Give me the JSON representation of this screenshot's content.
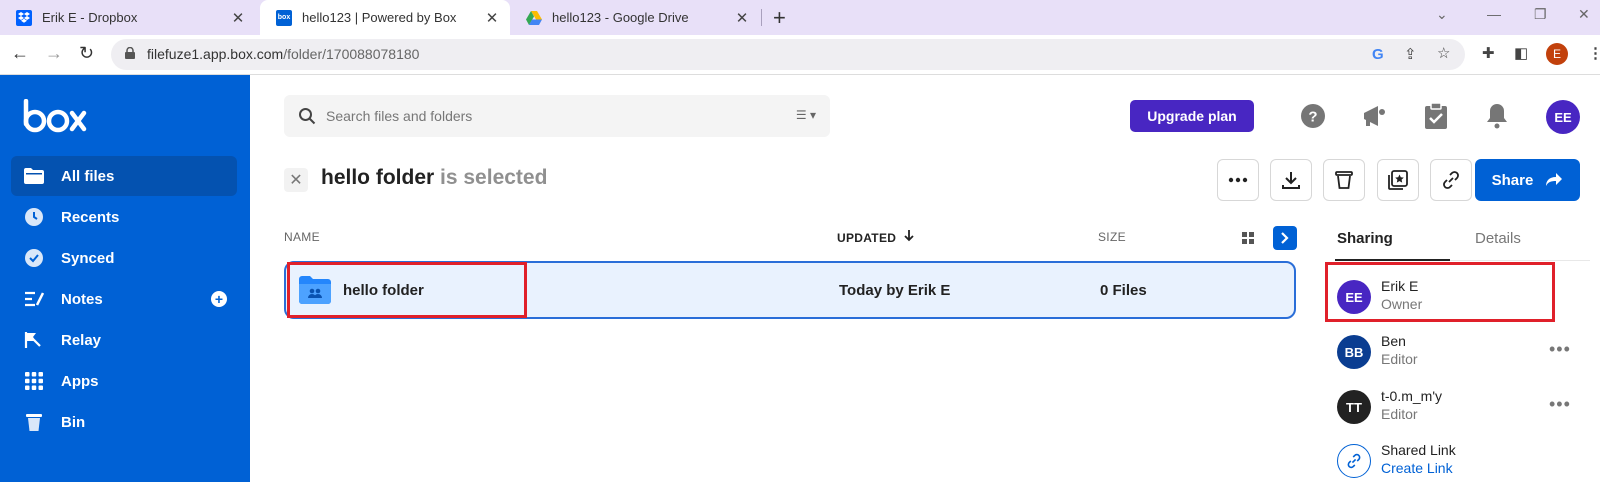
{
  "browser": {
    "tabs": [
      {
        "title": "Erik E - Dropbox",
        "favicon": "dropbox-icon"
      },
      {
        "title": "hello123 | Powered by Box",
        "favicon": "box-icon",
        "active": true
      },
      {
        "title": "hello123 - Google Drive",
        "favicon": "google-drive-icon"
      }
    ],
    "url_host": "filefuze1.app.box.com",
    "url_path": "/folder/170088078180",
    "profile_initial": "E"
  },
  "sidebar": {
    "logo": "box",
    "items": [
      {
        "label": "All files",
        "icon": "folder-icon",
        "active": true
      },
      {
        "label": "Recents",
        "icon": "clock-icon"
      },
      {
        "label": "Synced",
        "icon": "check-circle-icon"
      },
      {
        "label": "Notes",
        "icon": "notes-icon"
      },
      {
        "label": "Relay",
        "icon": "relay-icon"
      },
      {
        "label": "Apps",
        "icon": "apps-grid-icon"
      },
      {
        "label": "Bin",
        "icon": "trash-icon"
      }
    ]
  },
  "header": {
    "search_placeholder": "Search files and folders",
    "upgrade_label": "Upgrade plan",
    "avatar_initials": "EE"
  },
  "selection": {
    "name": "hello folder",
    "suffix": "is selected",
    "share_label": "Share"
  },
  "table": {
    "columns": {
      "name": "NAME",
      "updated": "UPDATED",
      "size": "SIZE"
    },
    "rows": [
      {
        "name": "hello folder",
        "updated": "Today by Erik E",
        "size": "0 Files"
      }
    ]
  },
  "panel": {
    "tabs": [
      "Sharing",
      "Details"
    ],
    "people": [
      {
        "initials": "EE",
        "name": "Erik E",
        "role": "Owner",
        "color": "#4826c2"
      },
      {
        "initials": "BB",
        "name": "Ben",
        "role": "Editor",
        "color": "#0a3d91"
      },
      {
        "initials": "TT",
        "name": "t-0.m_m'y",
        "role": "Editor",
        "color": "#222222"
      }
    ],
    "shared_link": {
      "title": "Shared Link",
      "action": "Create Link"
    }
  },
  "colors": {
    "brand": "#0061d5",
    "upgrade": "#4826c2",
    "highlight": "#e0202a"
  }
}
